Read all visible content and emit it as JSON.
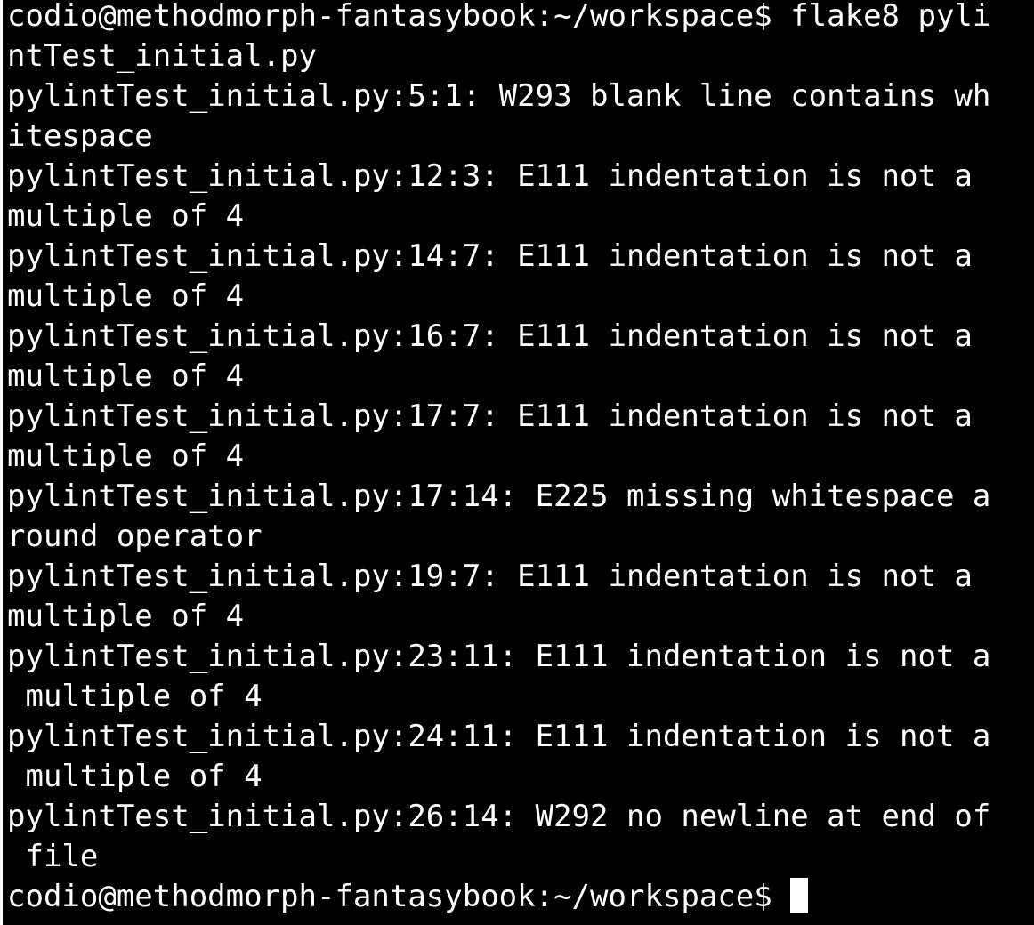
{
  "terminal": {
    "lines": [
      "codio@methodmorph-fantasybook:~/workspace$ flake8 pyli",
      "ntTest_initial.py",
      "pylintTest_initial.py:5:1: W293 blank line contains wh",
      "itespace",
      "pylintTest_initial.py:12:3: E111 indentation is not a",
      "multiple of 4",
      "pylintTest_initial.py:14:7: E111 indentation is not a",
      "multiple of 4",
      "pylintTest_initial.py:16:7: E111 indentation is not a",
      "multiple of 4",
      "pylintTest_initial.py:17:7: E111 indentation is not a",
      "multiple of 4",
      "pylintTest_initial.py:17:14: E225 missing whitespace a",
      "round operator",
      "pylintTest_initial.py:19:7: E111 indentation is not a",
      "multiple of 4",
      "pylintTest_initial.py:23:11: E111 indentation is not a",
      " multiple of 4",
      "pylintTest_initial.py:24:11: E111 indentation is not a",
      " multiple of 4",
      "pylintTest_initial.py:26:14: W292 no newline at end of",
      " file"
    ],
    "prompt": "codio@methodmorph-fantasybook:~/workspace$ "
  }
}
